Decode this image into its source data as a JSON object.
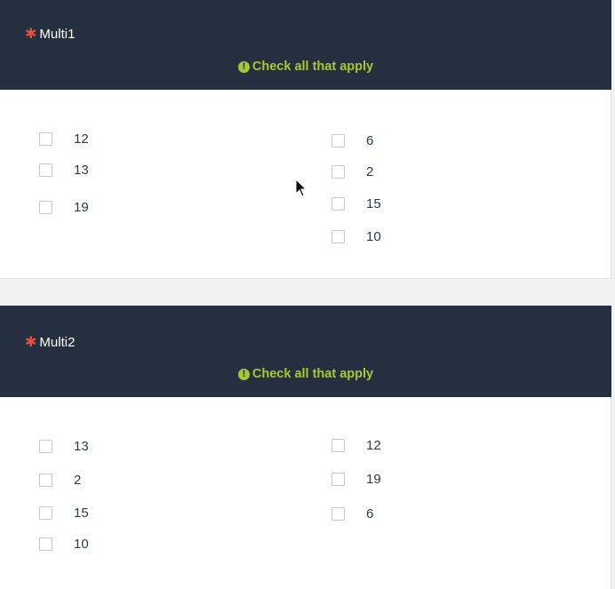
{
  "questions": [
    {
      "title": "Multi1",
      "hint": "Check all that apply",
      "left_options": [
        "12",
        "13",
        "19"
      ],
      "right_options": [
        "6",
        "2",
        "15",
        "10"
      ]
    },
    {
      "title": "Multi2",
      "hint": "Check all that apply",
      "left_options": [
        "13",
        "2",
        "15",
        "10"
      ],
      "right_options": [
        "12",
        "19",
        "6"
      ]
    }
  ],
  "colors": {
    "header_bg": "#243040",
    "required": "#e84c3d",
    "hint": "#a6c832"
  }
}
